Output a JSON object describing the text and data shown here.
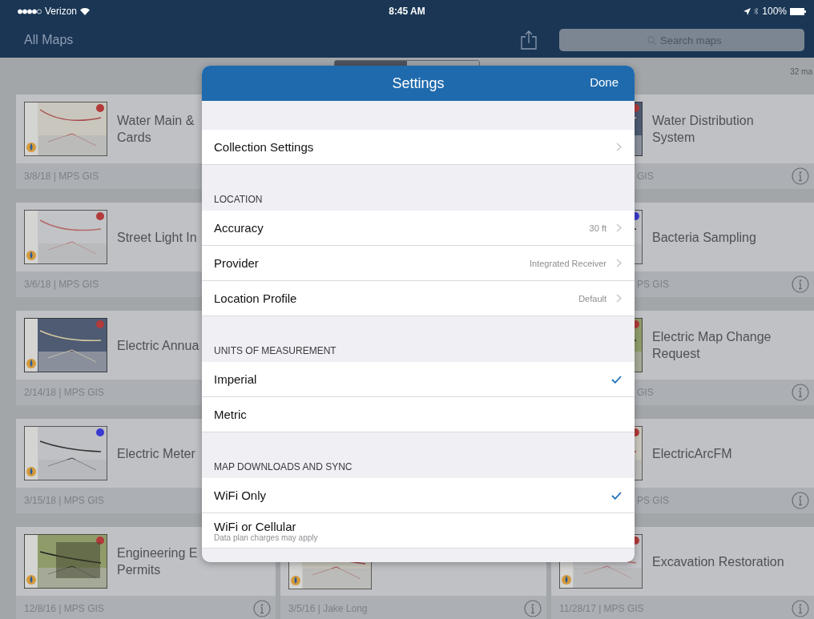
{
  "status_bar": {
    "carrier": "Verizon",
    "time": "8:45 AM",
    "battery": "100%"
  },
  "nav": {
    "title": "All Maps",
    "search": {
      "placeholder": "Search maps"
    }
  },
  "map_count": "32 ma",
  "columns": [
    {
      "cards": [
        {
          "title": "Water Main &\nCards",
          "footer": "3/8/18 | MPS GIS"
        },
        {
          "title": "Street Light In",
          "footer": "3/6/18 | MPS GIS"
        },
        {
          "title": "Electric Annua",
          "footer": "2/14/18 | MPS GIS"
        },
        {
          "title": "Electric Meter",
          "footer": "3/15/18 | MPS GIS"
        },
        {
          "title": "Engineering E\nPermits",
          "footer": "12/8/16 | MPS GIS"
        }
      ]
    },
    {
      "cards": [
        {
          "footer": "3/5/16 | Jake Long"
        }
      ]
    },
    {
      "cards": [
        {
          "title": "Water Distribution\nSystem",
          "footer": "GIS"
        },
        {
          "title": "Bacteria Sampling",
          "footer": "PS GIS"
        },
        {
          "title": "Electric Map Change\nRequest",
          "footer": "GIS"
        },
        {
          "title": "ElectricArcFM",
          "footer": "PS GIS"
        },
        {
          "title": "Excavation Restoration",
          "footer": "11/28/17 | MPS GIS"
        }
      ]
    }
  ],
  "settings": {
    "title": "Settings",
    "done": "Done",
    "sections": [
      {
        "rows": [
          {
            "kind": "disclosure",
            "label": "Collection Settings"
          }
        ]
      },
      {
        "header": "LOCATION",
        "rows": [
          {
            "kind": "disclosure",
            "label": "Accuracy",
            "value": "30 ft"
          },
          {
            "kind": "disclosure",
            "label": "Provider",
            "value": "Integrated Receiver"
          },
          {
            "kind": "disclosure",
            "label": "Location Profile",
            "value": "Default"
          }
        ]
      },
      {
        "header": "UNITS OF MEASUREMENT",
        "rows": [
          {
            "kind": "option",
            "label": "Imperial",
            "checked": true
          },
          {
            "kind": "option",
            "label": "Metric",
            "checked": false
          }
        ]
      },
      {
        "header": "MAP DOWNLOADS AND SYNC",
        "rows": [
          {
            "kind": "option",
            "label": "WiFi Only",
            "checked": true
          },
          {
            "kind": "option",
            "label": "WiFi or Cellular",
            "subtitle": "Data plan charges may apply",
            "checked": false
          }
        ]
      }
    ]
  }
}
